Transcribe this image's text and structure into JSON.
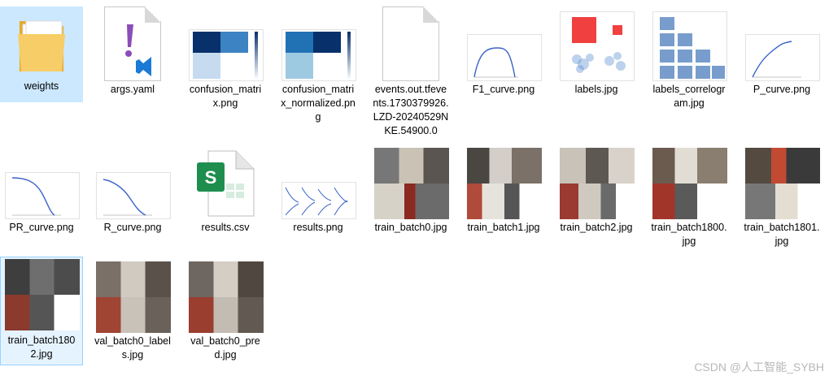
{
  "files": [
    {
      "name": "weights"
    },
    {
      "name": "args.yaml"
    },
    {
      "name": "confusion_matrix.png"
    },
    {
      "name": "confusion_matrix_normalized.png"
    },
    {
      "name": "events.out.tfevents.1730379926.LZD-20240529NKE.54900.0"
    },
    {
      "name": "F1_curve.png"
    },
    {
      "name": "labels.jpg"
    },
    {
      "name": "labels_correlogram.jpg"
    },
    {
      "name": "P_curve.png"
    },
    {
      "name": "PR_curve.png"
    },
    {
      "name": "R_curve.png"
    },
    {
      "name": "results.csv"
    },
    {
      "name": "results.png"
    },
    {
      "name": "train_batch0.jpg"
    },
    {
      "name": "train_batch1.jpg"
    },
    {
      "name": "train_batch2.jpg"
    },
    {
      "name": "train_batch1800.jpg"
    },
    {
      "name": "train_batch1801.jpg"
    },
    {
      "name": "train_batch1802.jpg"
    },
    {
      "name": "val_batch0_labels.jpg"
    },
    {
      "name": "val_batch0_pred.jpg"
    }
  ],
  "watermark": "CSDN @人工智能_SYBH",
  "colors": {
    "selection": "#cce8ff",
    "folder": "#f5c55a",
    "accent_blue": "#0b3c8c",
    "plot_line": "#3a63c8"
  }
}
